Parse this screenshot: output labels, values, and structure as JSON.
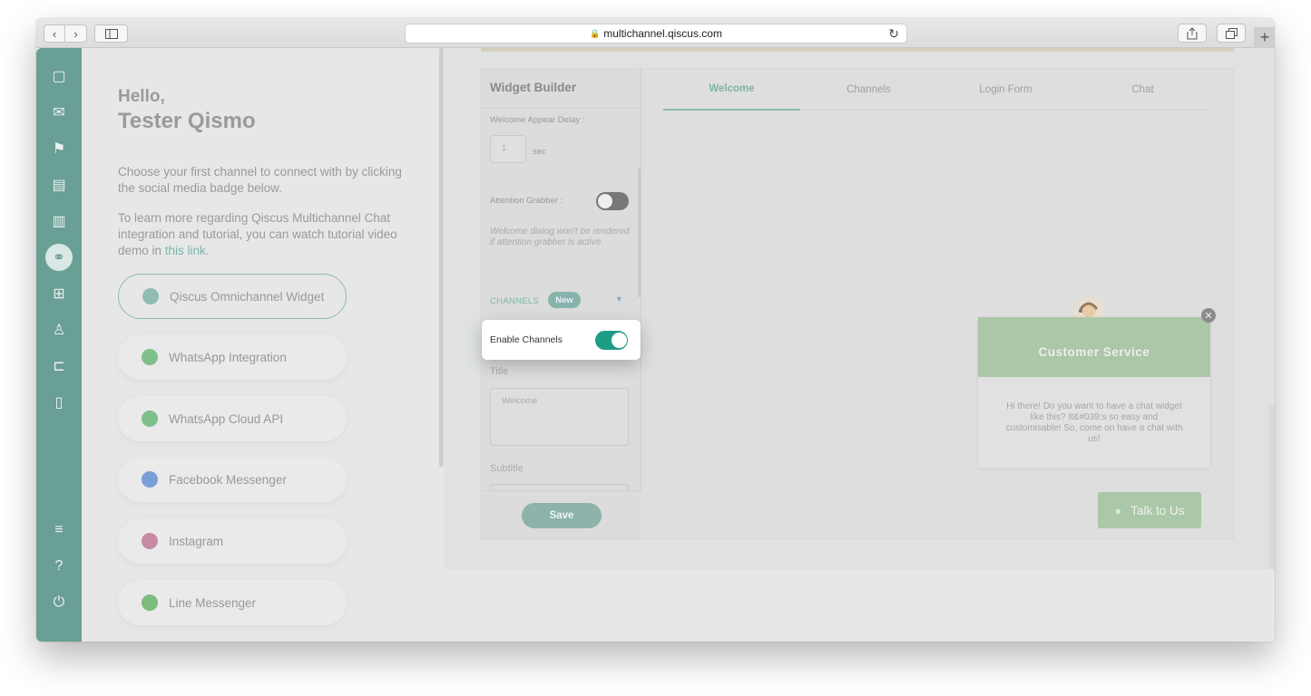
{
  "browser": {
    "url": "multichannel.qiscus.com",
    "back_glyph": "‹",
    "forward_glyph": "›",
    "new_tab_glyph": "+"
  },
  "rail": {
    "items": [
      {
        "name": "chat-icon",
        "glyph": "▢"
      },
      {
        "name": "mail-icon",
        "glyph": "✉"
      },
      {
        "name": "megaphone-icon",
        "glyph": "⚑"
      },
      {
        "name": "contact-card-icon",
        "glyph": "▤"
      },
      {
        "name": "analytics-icon",
        "glyph": "▥"
      },
      {
        "name": "integration-icon",
        "glyph": "⚭",
        "active": true
      },
      {
        "name": "apps-grid-icon",
        "glyph": "⊞"
      },
      {
        "name": "agent-icon",
        "glyph": "♙"
      },
      {
        "name": "ticket-icon",
        "glyph": "⊏"
      },
      {
        "name": "mobile-icon",
        "glyph": "▯"
      },
      {
        "name": "settings-sliders-icon",
        "glyph": "≡"
      },
      {
        "name": "help-icon",
        "glyph": "?"
      },
      {
        "name": "logout-icon",
        "glyph": "⏻"
      }
    ]
  },
  "welcome": {
    "hello": "Hello,",
    "name": "Tester Qismo",
    "intro": "Choose your first channel to connect with by clicking the social media badge below.",
    "tutorial_prefix": "To learn more regarding Qiscus Multichannel Chat integration and tutorial, you can watch tutorial video demo in ",
    "tutorial_link": "this link",
    "tutorial_suffix": "."
  },
  "channels": [
    {
      "label": "Qiscus Omnichannel Widget",
      "icon": "qiscus-icon",
      "color": "#8fbdb3",
      "active": true
    },
    {
      "label": "WhatsApp Integration",
      "icon": "whatsapp-icon",
      "color": "#7fbf8c"
    },
    {
      "label": "WhatsApp Cloud API",
      "icon": "whatsapp-icon",
      "color": "#7fbf8c"
    },
    {
      "label": "Facebook Messenger",
      "icon": "messenger-icon",
      "color": "#7a9fd6"
    },
    {
      "label": "Instagram",
      "icon": "instagram-icon",
      "color": "#c78aa5"
    },
    {
      "label": "Line Messenger",
      "icon": "line-icon",
      "color": "#7cbc7c"
    }
  ],
  "builder": {
    "title": "Widget Builder",
    "delay_label": "Welcome Appear Delay :",
    "delay_value": "1",
    "delay_unit": "sec",
    "attention_label": "Attention Grabber :",
    "attention_note": "Welcome dialog won't be rendered if attention grabber is active",
    "channels_label": "CHANNELS",
    "new_badge": "New",
    "enable_channels_label": "Enable Channels",
    "enable_channels_on": true,
    "title_label": "Title",
    "title_placeholder": "Welcome",
    "subtitle_label": "Subtitle",
    "save_label": "Save"
  },
  "preview": {
    "tabs": [
      {
        "label": "Welcome",
        "active": true
      },
      {
        "label": "Channels"
      },
      {
        "label": "Login Form"
      },
      {
        "label": "Chat"
      }
    ],
    "card_title": "Customer Service",
    "card_body": "Hi there! Do you want to have a chat widget like this? It&#039;s so easy and customisable! So, come on have a chat with us!",
    "talk_button": "Talk to Us"
  }
}
